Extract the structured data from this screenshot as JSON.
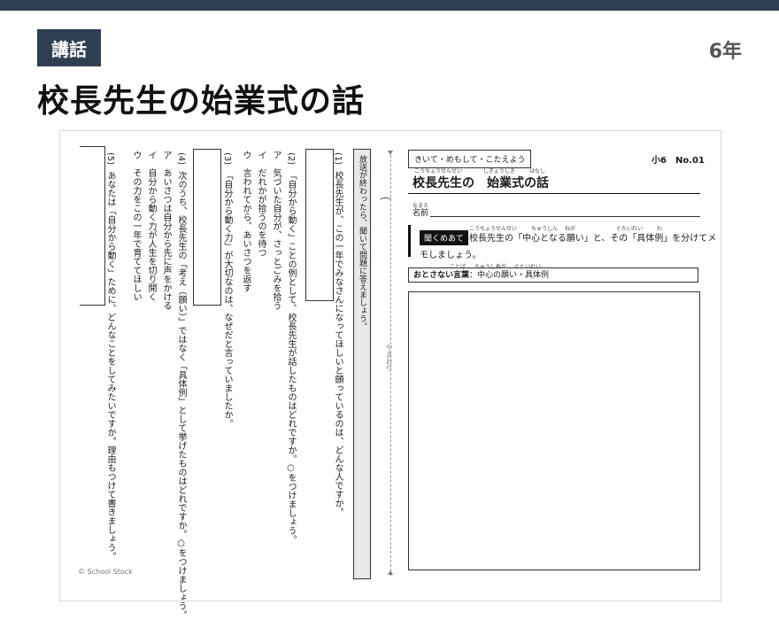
{
  "header": {
    "badge": "講話",
    "grade": "6年",
    "title": "校長先生の始業式の話"
  },
  "sheet": {
    "instruction": "放送が終わったら、聞いて問題に答えましょう。",
    "fold_label": "やまおり",
    "copyright": "© School Stock",
    "questions": {
      "q1": [
        "(1)",
        "校長先生が、この一年でみなさんになってほしいと願っているのは、どんな人ですか。"
      ],
      "q2": [
        "(2)",
        "「自分から動く」ことの例として、校長先生が話したものはどれですか。○をつけましょう。",
        "ア　気づいた自分が、さっとごみを拾う",
        "イ　だれかが拾うのを待つ",
        "ウ　言われてから、あいさつを返す"
      ],
      "q3": [
        "(3)",
        "「自分から動く力」が大切なのは、なぜだと言っていましたか。"
      ],
      "q4": [
        "(4)",
        "次のうち、校長先生の「考え（願い）」ではなく「具体例」として挙げたものはどれですか。○をつけましょう。",
        "ア　あいさつは自分から先に声をかける",
        "イ　自分から動く力が人生を切り開く",
        "ウ　その力をこの一年で育ててほしい"
      ],
      "q5": [
        "(5)",
        "あなたは「自分から動く」ために、どんなことをしてみたいですか。理由もつけて書きましょう。"
      ]
    },
    "right": {
      "header_label": "きいて・めもして・こたえよう",
      "sheet_no": "小6　No.01",
      "sheet_title": "校長先生の　始業式の話",
      "ruby": [
        "こうちょうせんせい",
        "しぎょうしき",
        "はなし",
        "なまえ",
        "こうちょうせんせい",
        "ちゅうしん",
        "ねが",
        "ぐたいれい",
        "わ",
        "ことば",
        "ちゅうしん",
        "ねが",
        "ぐたいれい"
      ],
      "name_label": "名前",
      "question_tag": "聞くめあて",
      "question_text_1": "校長先生の「中心となる願い」と、その「具体例」を分けてメ",
      "question_text_2": "モしましょう。",
      "key_label": "おとさない言葉",
      "key_words": "：中心の願い・具体例"
    }
  }
}
